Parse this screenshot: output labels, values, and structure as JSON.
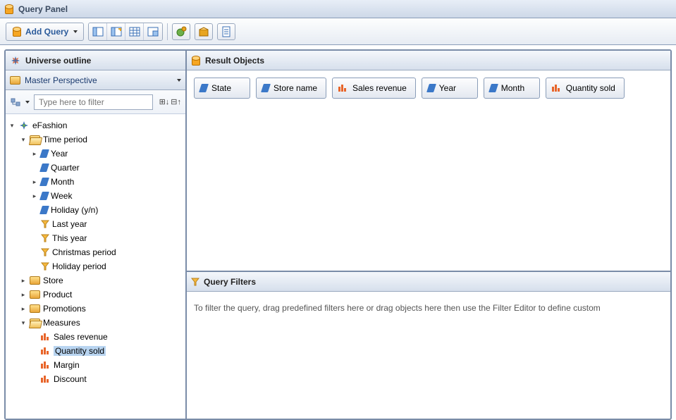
{
  "window": {
    "title": "Query Panel"
  },
  "toolbar": {
    "add_query_label": "Add Query"
  },
  "left": {
    "outline_title": "Universe outline",
    "perspective_label": "Master Perspective",
    "filter_placeholder": "Type here to filter"
  },
  "tree": {
    "root": "eFashion",
    "time_period": "Time period",
    "year": "Year",
    "quarter": "Quarter",
    "month": "Month",
    "week": "Week",
    "holiday_yn": "Holiday (y/n)",
    "last_year": "Last year",
    "this_year": "This year",
    "christmas": "Christmas period",
    "holiday_period": "Holiday period",
    "store": "Store",
    "product": "Product",
    "promotions": "Promotions",
    "measures": "Measures",
    "sales_revenue": "Sales revenue",
    "quantity_sold": "Quantity sold",
    "margin": "Margin",
    "discount": "Discount"
  },
  "result": {
    "title": "Result Objects",
    "chips": [
      {
        "label": "State",
        "type": "dimension"
      },
      {
        "label": "Store name",
        "type": "dimension"
      },
      {
        "label": "Sales revenue",
        "type": "measure"
      },
      {
        "label": "Year",
        "type": "dimension"
      },
      {
        "label": "Month",
        "type": "dimension"
      },
      {
        "label": "Quantity sold",
        "type": "measure"
      }
    ]
  },
  "filters": {
    "title": "Query Filters",
    "hint": "To filter the query, drag predefined filters here or drag objects here then use the Filter Editor to define custom"
  }
}
